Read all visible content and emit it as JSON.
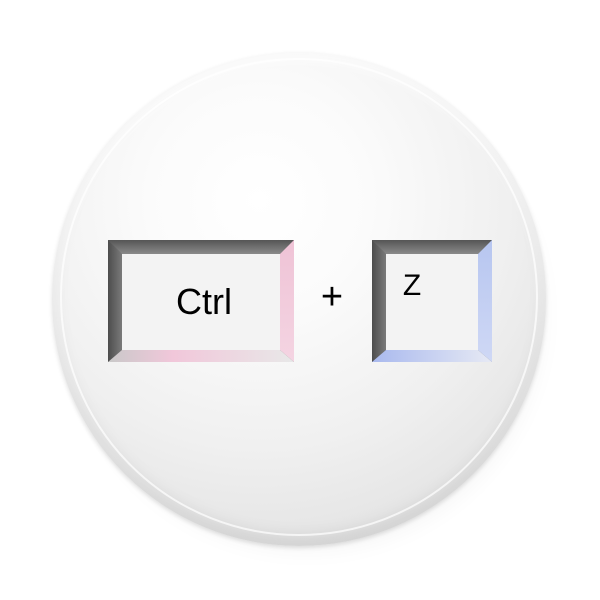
{
  "keys": {
    "ctrl_label": "Ctrl",
    "plus_label": "+",
    "z_label": "Z"
  },
  "colors": {
    "pin_face": "#f2f2f2",
    "key_border_dark": "#5a5a5a",
    "ctrl_accent": "#efc6d8",
    "z_accent": "#b9c6ee",
    "text": "#000000"
  }
}
